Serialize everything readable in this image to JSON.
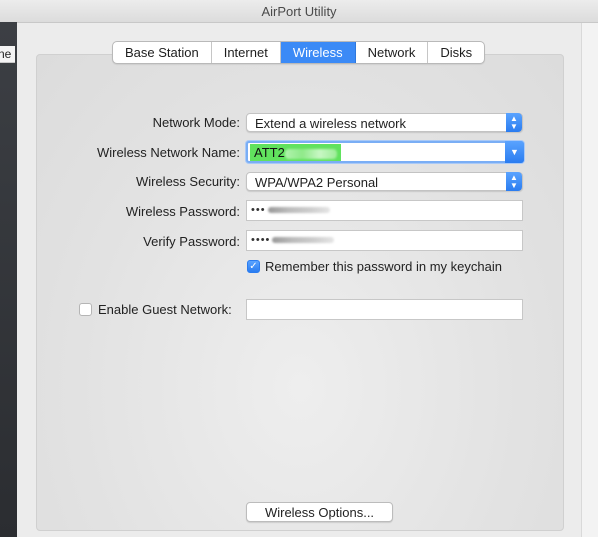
{
  "app": {
    "title": "AirPort Utility"
  },
  "background_window": {
    "clipped_text": "ne"
  },
  "tabs": [
    {
      "label": "Base Station",
      "active": false
    },
    {
      "label": "Internet",
      "active": false
    },
    {
      "label": "Wireless",
      "active": true
    },
    {
      "label": "Network",
      "active": false
    },
    {
      "label": "Disks",
      "active": false
    }
  ],
  "form": {
    "network_mode": {
      "label": "Network Mode:",
      "value": "Extend a wireless network"
    },
    "wireless_network_name": {
      "label": "Wireless Network Name:",
      "value": "ATT2"
    },
    "wireless_security": {
      "label": "Wireless Security:",
      "value": "WPA/WPA2 Personal"
    },
    "wireless_password": {
      "label": "Wireless Password:",
      "value": "•••"
    },
    "verify_password": {
      "label": "Verify Password:",
      "value": "••••"
    },
    "remember_password": {
      "label": "Remember this password in my keychain",
      "checked": true
    },
    "guest_network": {
      "label": "Enable Guest Network:",
      "checked": false,
      "value": ""
    }
  },
  "buttons": {
    "wireless_options": "Wireless Options..."
  },
  "colors": {
    "accent": "#3b8af6",
    "highlight_green": "#61e25e"
  }
}
